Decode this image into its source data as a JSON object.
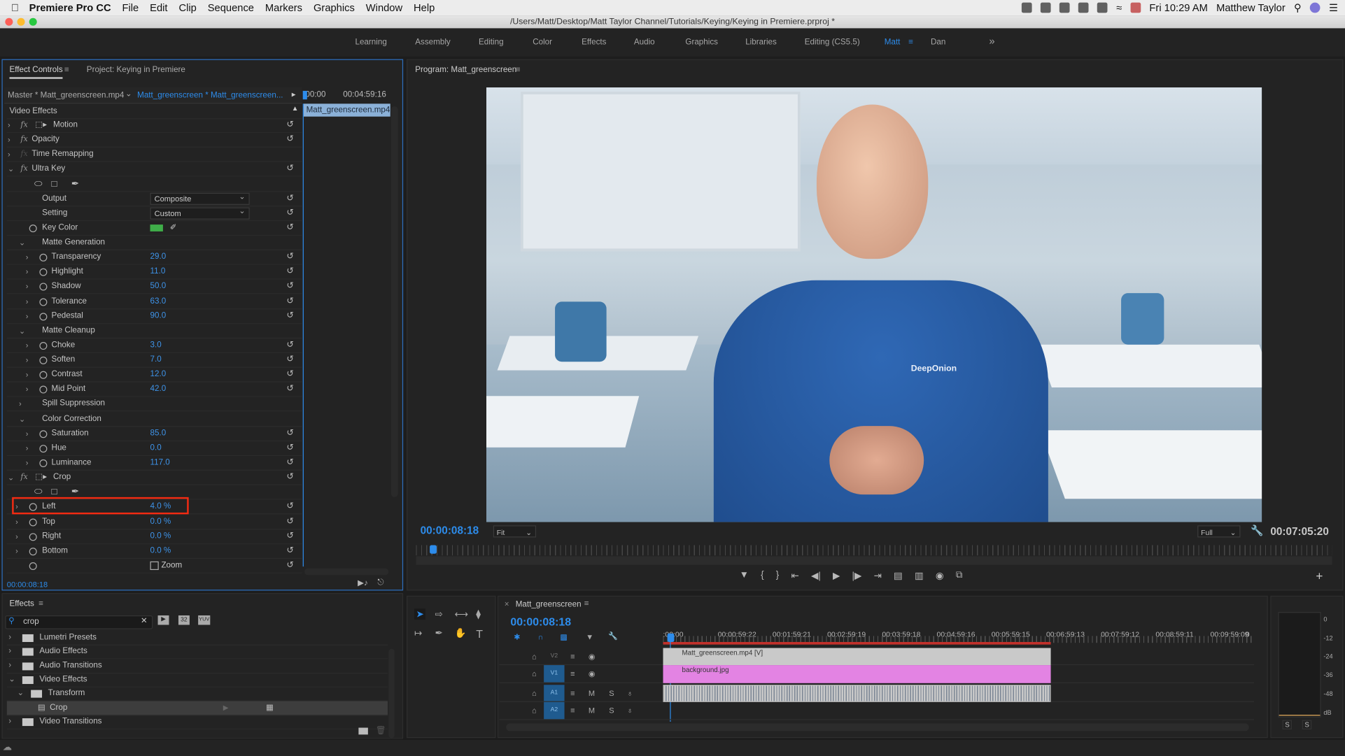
{
  "menubar": {
    "app": "Premiere Pro CC",
    "items": [
      "File",
      "Edit",
      "Clip",
      "Sequence",
      "Markers",
      "Graphics",
      "Window",
      "Help"
    ],
    "clock": "Fri 10:29 AM",
    "user": "Matthew Taylor"
  },
  "window": {
    "title": "/Users/Matt/Desktop/Matt Taylor Channel/Tutorials/Keying/Keying in Premiere.prproj *"
  },
  "workspaces": {
    "items": [
      "Learning",
      "Assembly",
      "Editing",
      "Color",
      "Effects",
      "Audio",
      "Graphics",
      "Libraries",
      "Editing (CS5.5)",
      "Matt",
      "Dan"
    ],
    "active": "Matt",
    "more": "»"
  },
  "effect_controls": {
    "tab": "Effect Controls",
    "tab2": "Project: Keying in Premiere",
    "master": "Master * Matt_greenscreen.mp4",
    "sequence": "Matt_greenscreen * Matt_greenscreen...",
    "ruler_start": "00:00",
    "ruler_end": "00:04:59:16",
    "clip": "Matt_greenscreen.mp4",
    "section": "Video Effects",
    "timecode": "00:00:08:18",
    "rows": [
      {
        "label": "Motion",
        "level": 0,
        "exp": ">",
        "fx": true,
        "transform": true,
        "reset": true
      },
      {
        "label": "Opacity",
        "level": 0,
        "exp": ">",
        "fx": true,
        "reset": true
      },
      {
        "label": "Time Remapping",
        "level": 0,
        "exp": ">",
        "fx": true,
        "fxdim": true
      },
      {
        "label": "Ultra Key",
        "level": 0,
        "exp": "v",
        "fx": true,
        "reset": true
      },
      {
        "kind": "masks"
      },
      {
        "label": "Output",
        "level": 1,
        "dropdown": "Composite",
        "reset": true
      },
      {
        "label": "Setting",
        "level": 1,
        "dropdown": "Custom",
        "reset": true
      },
      {
        "label": "Key Color",
        "level": 1,
        "sw": true,
        "swatch": "#3fae49",
        "reset": true
      },
      {
        "label": "Matte Generation",
        "level": 1,
        "exp": "v"
      },
      {
        "label": "Transparency",
        "level": 2,
        "exp": ">",
        "sw": true,
        "value": "29.0",
        "reset": true
      },
      {
        "label": "Highlight",
        "level": 2,
        "exp": ">",
        "sw": true,
        "value": "11.0",
        "reset": true
      },
      {
        "label": "Shadow",
        "level": 2,
        "exp": ">",
        "sw": true,
        "value": "50.0",
        "reset": true
      },
      {
        "label": "Tolerance",
        "level": 2,
        "exp": ">",
        "sw": true,
        "value": "63.0",
        "reset": true
      },
      {
        "label": "Pedestal",
        "level": 2,
        "exp": ">",
        "sw": true,
        "value": "90.0",
        "reset": true
      },
      {
        "label": "Matte Cleanup",
        "level": 1,
        "exp": "v"
      },
      {
        "label": "Choke",
        "level": 2,
        "exp": ">",
        "sw": true,
        "value": "3.0",
        "reset": true
      },
      {
        "label": "Soften",
        "level": 2,
        "exp": ">",
        "sw": true,
        "value": "7.0",
        "reset": true
      },
      {
        "label": "Contrast",
        "level": 2,
        "exp": ">",
        "sw": true,
        "value": "12.0",
        "reset": true
      },
      {
        "label": "Mid Point",
        "level": 2,
        "exp": ">",
        "sw": true,
        "value": "42.0",
        "reset": true
      },
      {
        "label": "Spill Suppression",
        "level": 1,
        "exp": ">"
      },
      {
        "label": "Color Correction",
        "level": 1,
        "exp": "v"
      },
      {
        "label": "Saturation",
        "level": 2,
        "exp": ">",
        "sw": true,
        "value": "85.0",
        "reset": true
      },
      {
        "label": "Hue",
        "level": 2,
        "exp": ">",
        "sw": true,
        "value": "0.0",
        "reset": true
      },
      {
        "label": "Luminance",
        "level": 2,
        "exp": ">",
        "sw": true,
        "value": "117.0",
        "reset": true
      },
      {
        "label": "Crop",
        "level": 0,
        "exp": "v",
        "fx": true,
        "transform": true,
        "reset": true
      },
      {
        "kind": "masks"
      },
      {
        "label": "Left",
        "level": 1,
        "exp": ">",
        "sw": true,
        "value": "4.0 %",
        "reset": true,
        "highlight": true
      },
      {
        "label": "Top",
        "level": 1,
        "exp": ">",
        "sw": true,
        "value": "0.0 %",
        "reset": true
      },
      {
        "label": "Right",
        "level": 1,
        "exp": ">",
        "sw": true,
        "value": "0.0 %",
        "reset": true
      },
      {
        "label": "Bottom",
        "level": 1,
        "exp": ">",
        "sw": true,
        "value": "0.0 %",
        "reset": true
      },
      {
        "label": "",
        "level": 1,
        "sw": true,
        "checkbox": "Zoom",
        "reset": true
      }
    ]
  },
  "program": {
    "title": "Program: Matt_greenscreen",
    "timecode": "00:00:08:18",
    "fit": "Fit",
    "quality": "Full",
    "duration": "00:07:05:20",
    "shirt_logo": "DeepOnion",
    "playhead_fraction": 0.015
  },
  "effects": {
    "tab": "Effects",
    "search": "crop",
    "badges": [
      "32",
      "YUV"
    ],
    "items": [
      {
        "label": "Lumetri Presets",
        "level": 0,
        "exp": ">"
      },
      {
        "label": "Audio Effects",
        "level": 0,
        "exp": ">"
      },
      {
        "label": "Audio Transitions",
        "level": 0,
        "exp": ">"
      },
      {
        "label": "Video Effects",
        "level": 0,
        "exp": "v"
      },
      {
        "label": "Transform",
        "level": 1,
        "exp": "v"
      },
      {
        "label": "Crop",
        "level": 2,
        "effect": true,
        "selected": true
      },
      {
        "label": "Video Transitions",
        "level": 0,
        "exp": ">"
      }
    ]
  },
  "timeline": {
    "tab": "Matt_greenscreen",
    "timecode": "00:00:08:18",
    "ruler": [
      ":00:00",
      "00:00:59:22",
      "00:01:59:21",
      "00:02:59:19",
      "00:03:59:18",
      "00:04:59:16",
      "00:05:59:15",
      "00:06:59:13",
      "00:07:59:12",
      "00:08:59:11",
      "00:09:59:09",
      "0"
    ],
    "tracks": [
      {
        "name": "V2",
        "type": "video"
      },
      {
        "name": "V1",
        "type": "video"
      },
      {
        "name": "A1",
        "type": "audio"
      },
      {
        "name": "A2",
        "type": "audio"
      }
    ],
    "mute": "M",
    "solo": "S",
    "clips": [
      {
        "name": "Matt_greenscreen.mp4 [V]",
        "track": "V2",
        "color": "#c9c9c9"
      },
      {
        "name": "background.jpg",
        "track": "V1",
        "color": "#e383e3"
      }
    ]
  },
  "meter": {
    "scale": [
      "0",
      "-12",
      "-24",
      "-36",
      "-48",
      "dB"
    ],
    "solo": [
      "S",
      "S"
    ]
  }
}
